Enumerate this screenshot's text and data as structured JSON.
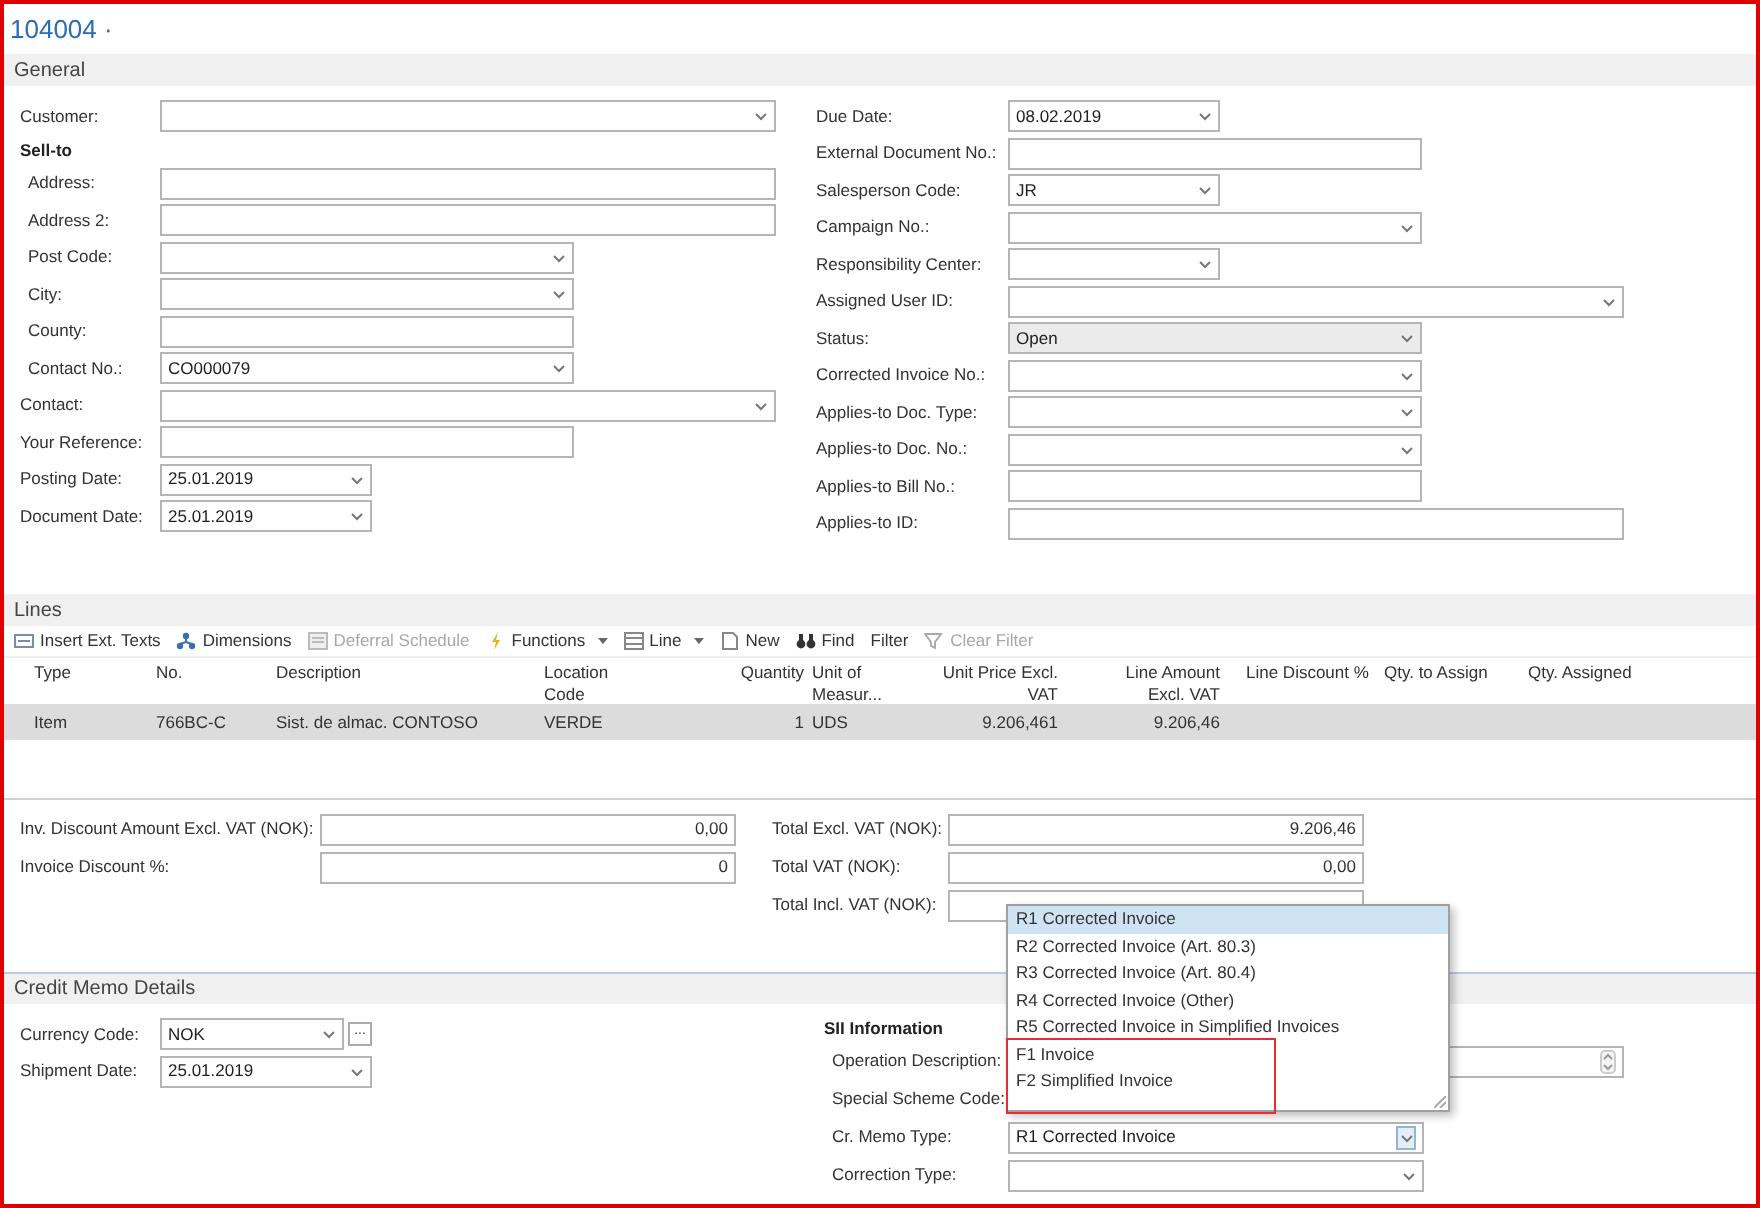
{
  "title": "104004 ·",
  "general": {
    "header": "General",
    "left": [
      {
        "kind": "select",
        "label": "Customer:",
        "readonly": false
      },
      {
        "kind": "group",
        "heading": "Sell-to",
        "fields": [
          {
            "kind": "text",
            "label": "Address:",
            "readonly": false
          },
          {
            "kind": "text",
            "label": "Address 2:",
            "readonly": false
          },
          {
            "kind": "select",
            "label": "Post Code:",
            "readonly": false
          },
          {
            "kind": "select",
            "label": "City:",
            "readonly": false
          },
          {
            "kind": "text",
            "label": "County:",
            "readonly": false
          },
          {
            "kind": "select",
            "label": "Contact No.:",
            "value": "CO000079",
            "readonly": false
          }
        ]
      },
      {
        "kind": "select",
        "label": "Contact:",
        "readonly": false
      },
      {
        "kind": "text",
        "label": "Your Reference:",
        "readonly": false
      },
      {
        "kind": "select",
        "label": "Posting Date:",
        "value": "25.01.2019",
        "readonly": false
      },
      {
        "kind": "select",
        "label": "Document Date:",
        "value": "25.01.2019",
        "readonly": false
      }
    ],
    "right": [
      {
        "kind": "select",
        "label": "Due Date:",
        "value": "08.02.2019",
        "readonly": false
      },
      {
        "kind": "text",
        "label": "External Document No.:",
        "readonly": false
      },
      {
        "kind": "select",
        "label": "Salesperson Code:",
        "value": "JR",
        "readonly": false
      },
      {
        "kind": "select",
        "label": "Campaign No.:",
        "readonly": false
      },
      {
        "kind": "select",
        "label": "Responsibility Center:",
        "readonly": false
      },
      {
        "kind": "select",
        "label": "Assigned User ID:",
        "readonly": false
      },
      {
        "kind": "select",
        "label": "Status:",
        "value": "Open",
        "readonly": true
      },
      {
        "kind": "select",
        "label": "Corrected Invoice No.:",
        "readonly": false
      },
      {
        "kind": "select",
        "label": "Applies-to Doc. Type:",
        "readonly": false
      },
      {
        "kind": "select",
        "label": "Applies-to Doc. No.:",
        "readonly": false
      },
      {
        "kind": "text",
        "label": "Applies-to Bill No.:",
        "readonly": false
      },
      {
        "kind": "text",
        "label": "Applies-to ID:",
        "readonly": false
      }
    ]
  },
  "lines": {
    "header": "Lines",
    "toolbar": [
      {
        "kind": "text-lines",
        "label": "Insert Ext. Texts",
        "disabled": false,
        "menu": false
      },
      {
        "kind": "dimensions",
        "label": "Dimensions",
        "disabled": false,
        "menu": false
      },
      {
        "kind": "schedule",
        "label": "Deferral Schedule",
        "disabled": true,
        "menu": false
      },
      {
        "kind": "bolt",
        "label": "Functions",
        "disabled": false,
        "menu": true
      },
      {
        "kind": "grid",
        "label": "Line",
        "disabled": false,
        "menu": true
      },
      {
        "kind": "page",
        "label": "New",
        "disabled": false,
        "menu": false
      },
      {
        "kind": "binoculars",
        "label": "Find",
        "disabled": false,
        "menu": false
      },
      {
        "kind": "plain",
        "label": "Filter",
        "disabled": false,
        "menu": false
      },
      {
        "kind": "funnel",
        "label": "Clear Filter",
        "disabled": true,
        "menu": false
      }
    ],
    "columns": [
      "Type",
      "No.",
      "Description",
      "Location Code",
      "Quantity",
      "Unit of Measur...",
      "Unit Price Excl. VAT",
      "Line Amount Excl. VAT",
      "Line Discount %",
      "Qty. to Assign",
      "Qty. Assigned"
    ],
    "rows": [
      {
        "selected": true,
        "cells": [
          "Item",
          "766BC-C",
          "Sist. de almac. CONTOSO",
          "VERDE",
          "1",
          "UDS",
          "9.206,461",
          "9.206,46",
          null,
          null,
          null
        ]
      }
    ]
  },
  "totals": {
    "left": [
      {
        "label": "Inv. Discount Amount Excl. VAT (NOK):",
        "value": "0,00"
      },
      {
        "label": "Invoice Discount %:",
        "value": "0"
      }
    ],
    "right": [
      {
        "label": "Total Excl. VAT (NOK):",
        "value": "9.206,46"
      },
      {
        "label": "Total VAT (NOK):",
        "value": "0,00"
      },
      {
        "label": "Total Incl. VAT (NOK):"
      }
    ]
  },
  "credit_memo": {
    "header": "Credit Memo Details",
    "left": [
      {
        "kind": "select",
        "label": "Currency Code:",
        "value": "NOK",
        "assist": "..."
      },
      {
        "kind": "select",
        "label": "Shipment Date:",
        "value": "25.01.2019"
      }
    ],
    "sii": {
      "heading": "SII Information",
      "fields": [
        {
          "kind": "textarea",
          "label": "Operation Description:",
          "open": false
        },
        {
          "kind": "label",
          "label": "Special Scheme Code:",
          "open": false
        },
        {
          "kind": "select",
          "label": "Cr. Memo Type:",
          "value": "R1 Corrected Invoice",
          "open": true
        },
        {
          "kind": "select",
          "label": "Correction Type:",
          "open": false
        }
      ]
    }
  },
  "dropdown": {
    "items": [
      {
        "label": "R1 Corrected Invoice",
        "selected": true
      },
      {
        "label": "R2 Corrected Invoice (Art. 80.3)",
        "selected": false
      },
      {
        "label": "R3 Corrected Invoice (Art. 80.4)",
        "selected": false
      },
      {
        "label": "R4 Corrected Invoice (Other)",
        "selected": false
      },
      {
        "label": "R5 Corrected Invoice in Simplified Invoices",
        "selected": false
      },
      {
        "label": "F1 Invoice",
        "selected": false
      },
      {
        "label": "F2 Simplified Invoice",
        "selected": false
      }
    ]
  }
}
